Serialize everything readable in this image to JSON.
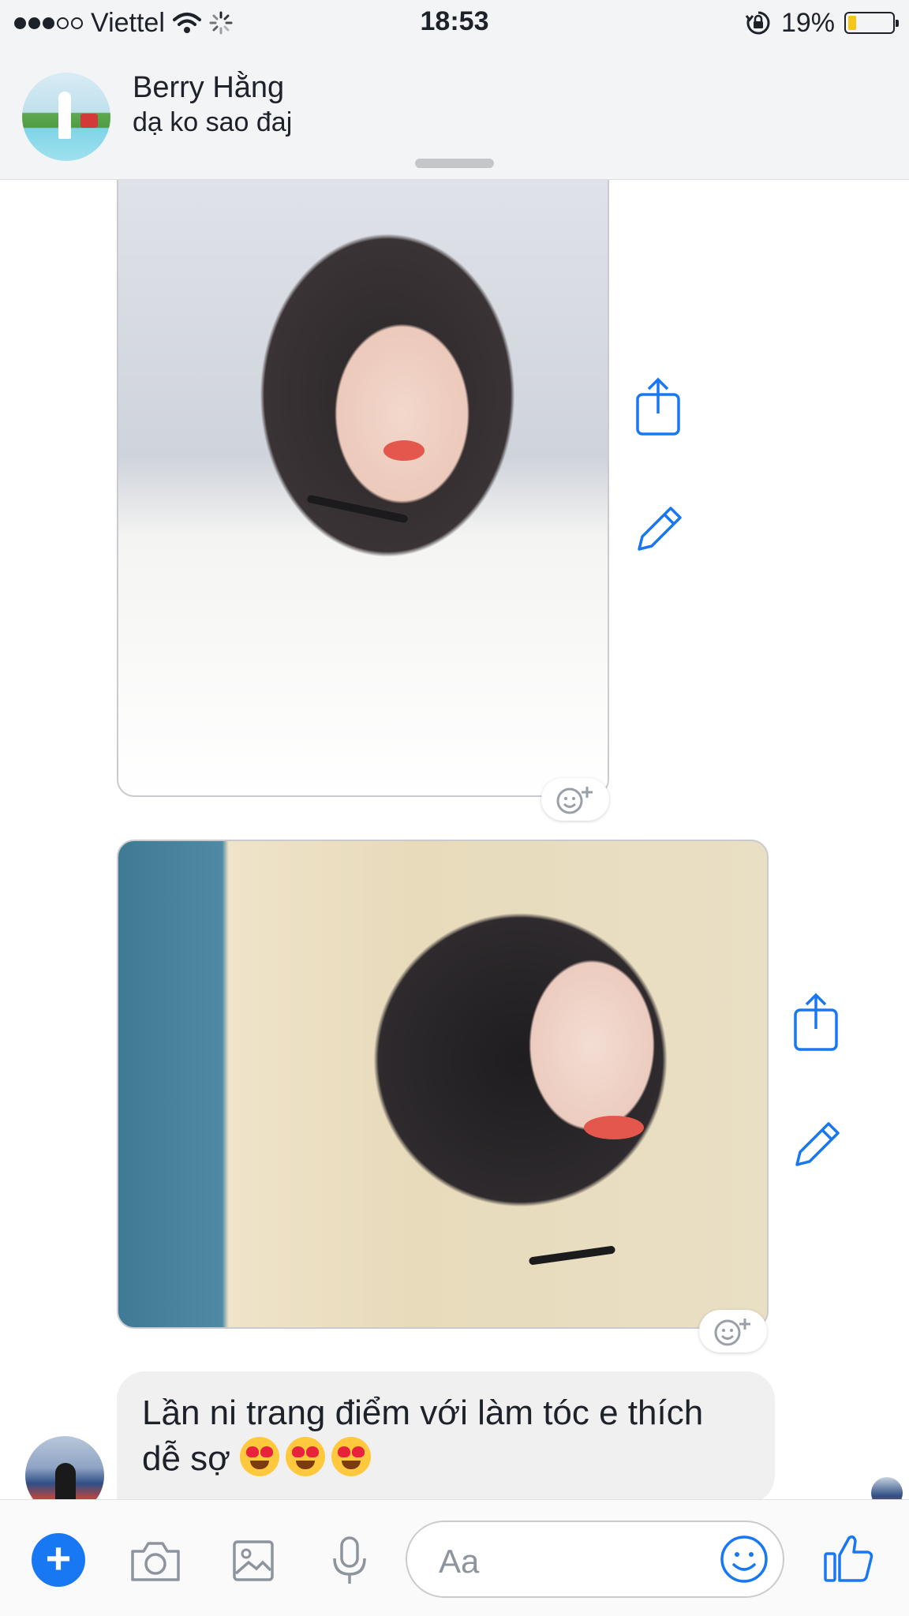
{
  "status_bar": {
    "carrier": "Viettel",
    "time": "18:53",
    "battery": "19%",
    "battery_level": 0.19
  },
  "header": {
    "contact_name": "Berry Hằng",
    "status_text": "dạ ko sao đaj"
  },
  "messages": [
    {
      "type": "photo",
      "description_icon": "photo"
    },
    {
      "type": "photo",
      "description_icon": "photo"
    },
    {
      "type": "text",
      "text": "Lần ni trang điểm với làm tóc e thích dễ sợ",
      "emoji_count": 3
    }
  ],
  "composer": {
    "placeholder": "Aa"
  },
  "colors": {
    "accent": "#1877f2",
    "bar_bg": "#f3f4f6",
    "bubble_bg": "#f1f0f0",
    "battery_fill": "#f5c518"
  }
}
